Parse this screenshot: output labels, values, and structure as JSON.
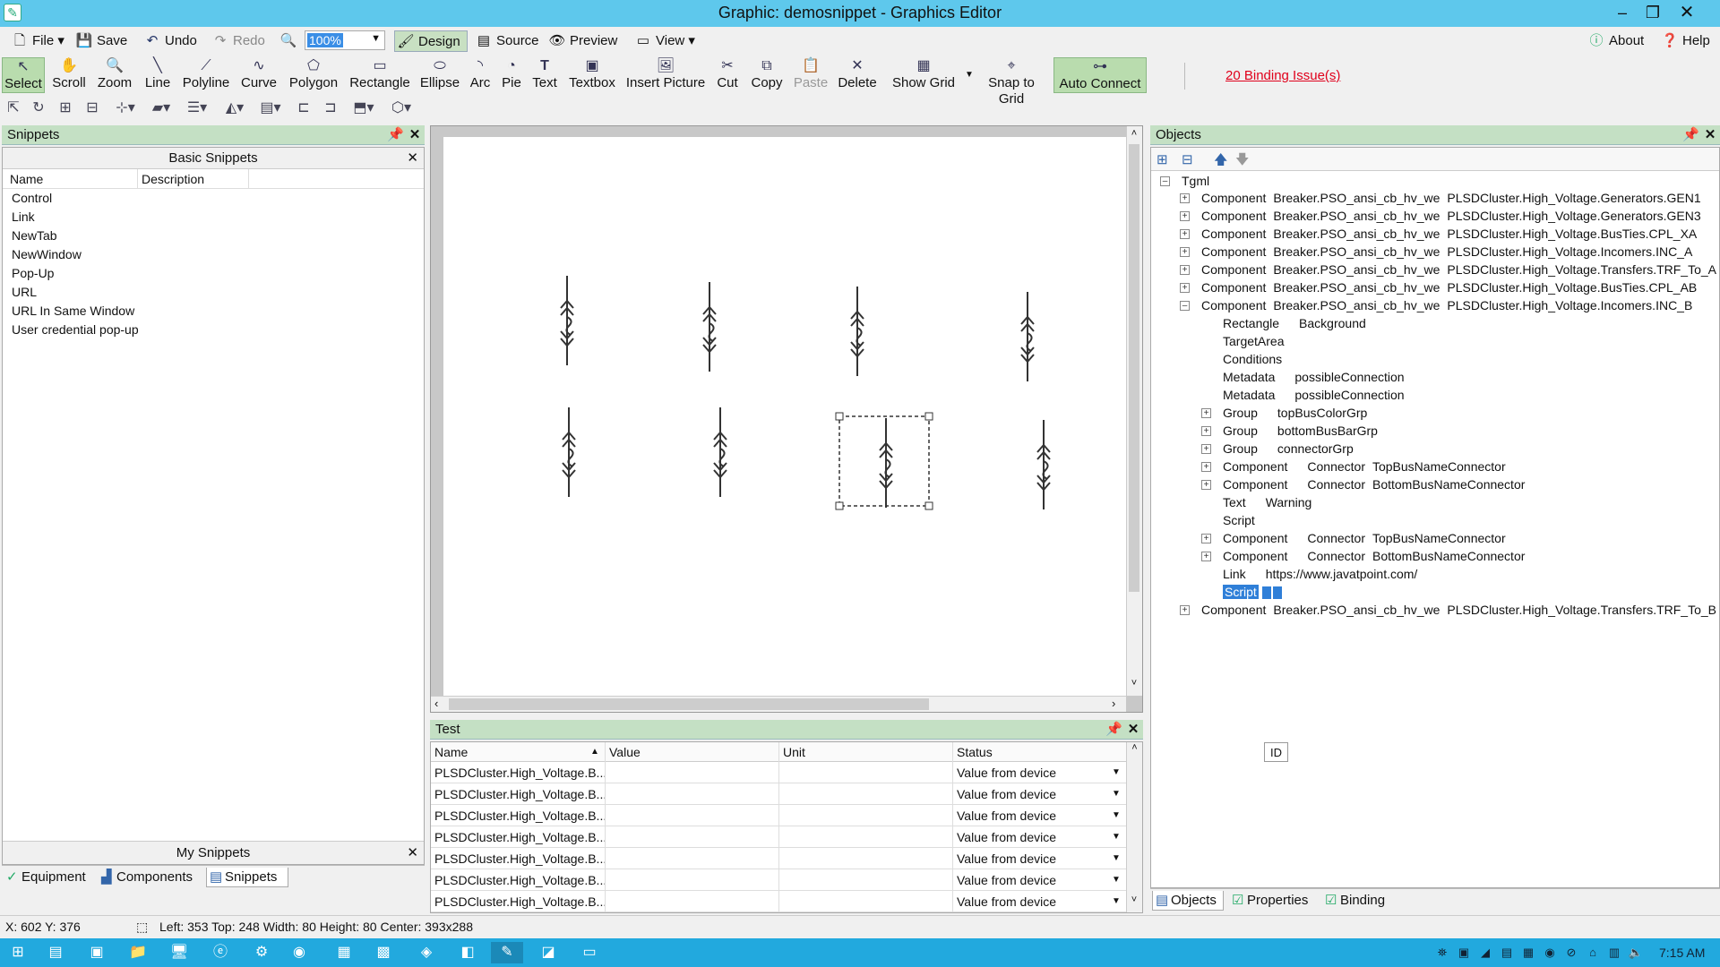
{
  "window": {
    "title": "Graphic: demosnippet - Graphics Editor"
  },
  "menu": {
    "file": "File",
    "save": "Save",
    "undo": "Undo",
    "redo": "Redo",
    "zoom_value": "100%",
    "design": "Design",
    "source": "Source",
    "preview": "Preview",
    "view": "View",
    "about": "About",
    "help": "Help"
  },
  "toolbar": {
    "items": [
      "Select",
      "Scroll",
      "Zoom",
      "Line",
      "Polyline",
      "Curve",
      "Polygon",
      "Rectangle",
      "Ellipse",
      "Arc",
      "Pie",
      "Text",
      "Textbox",
      "Insert Picture",
      "Cut",
      "Copy",
      "Paste",
      "Delete",
      "Show Grid",
      "Snap to Grid",
      "Auto Connect"
    ],
    "binding_issues": "20 Binding Issue(s)"
  },
  "snippets": {
    "panel_title": "Snippets",
    "section_title": "Basic Snippets",
    "col_name": "Name",
    "col_desc": "Description",
    "items": [
      "Control",
      "Link",
      "NewTab",
      "NewWindow",
      "Pop-Up",
      "URL",
      "URL In Same Window",
      "User credential pop-up"
    ],
    "my_snippets": "My Snippets"
  },
  "left_tabs": [
    "Equipment",
    "Components",
    "Snippets"
  ],
  "objects": {
    "panel_title": "Objects",
    "root": "Tgml",
    "rows": [
      {
        "level": 1,
        "exp": "+",
        "a": "Component",
        "b": "Breaker.PSO_ansi_cb_hv_we",
        "c": "PLSDCluster.High_Voltage.Generators.GEN1"
      },
      {
        "level": 1,
        "exp": "+",
        "a": "Component",
        "b": "Breaker.PSO_ansi_cb_hv_we",
        "c": "PLSDCluster.High_Voltage.Generators.GEN3"
      },
      {
        "level": 1,
        "exp": "+",
        "a": "Component",
        "b": "Breaker.PSO_ansi_cb_hv_we",
        "c": "PLSDCluster.High_Voltage.BusTies.CPL_XA"
      },
      {
        "level": 1,
        "exp": "+",
        "a": "Component",
        "b": "Breaker.PSO_ansi_cb_hv_we",
        "c": "PLSDCluster.High_Voltage.Incomers.INC_A"
      },
      {
        "level": 1,
        "exp": "+",
        "a": "Component",
        "b": "Breaker.PSO_ansi_cb_hv_we",
        "c": "PLSDCluster.High_Voltage.Transfers.TRF_To_A"
      },
      {
        "level": 1,
        "exp": "+",
        "a": "Component",
        "b": "Breaker.PSO_ansi_cb_hv_we",
        "c": "PLSDCluster.High_Voltage.BusTies.CPL_AB"
      },
      {
        "level": 1,
        "exp": "-",
        "a": "Component",
        "b": "Breaker.PSO_ansi_cb_hv_we",
        "c": "PLSDCluster.High_Voltage.Incomers.INC_B"
      },
      {
        "level": 2,
        "exp": "",
        "a": "Rectangle",
        "b": "Background",
        "c": ""
      },
      {
        "level": 2,
        "exp": "",
        "a": "TargetArea",
        "b": "",
        "c": ""
      },
      {
        "level": 2,
        "exp": "",
        "a": "Conditions",
        "b": "",
        "c": ""
      },
      {
        "level": 2,
        "exp": "",
        "a": "Metadata",
        "b": "possibleConnection",
        "c": ""
      },
      {
        "level": 2,
        "exp": "",
        "a": "Metadata",
        "b": "possibleConnection",
        "c": ""
      },
      {
        "level": 2,
        "exp": "+",
        "a": "Group",
        "b": "topBusColorGrp",
        "c": ""
      },
      {
        "level": 2,
        "exp": "+",
        "a": "Group",
        "b": "bottomBusBarGrp",
        "c": ""
      },
      {
        "level": 2,
        "exp": "+",
        "a": "Group",
        "b": "connectorGrp",
        "c": ""
      },
      {
        "level": 2,
        "exp": "+",
        "a": "Component",
        "b": "Connector",
        "c": "TopBusNameConnector"
      },
      {
        "level": 2,
        "exp": "+",
        "a": "Component",
        "b": "Connector",
        "c": "BottomBusNameConnector"
      },
      {
        "level": 2,
        "exp": "",
        "a": "Text",
        "b": "Warning",
        "c": ""
      },
      {
        "level": 2,
        "exp": "",
        "a": "Script",
        "b": "",
        "c": ""
      },
      {
        "level": 2,
        "exp": "+",
        "a": "Component",
        "b": "Connector",
        "c": "TopBusNameConnector"
      },
      {
        "level": 2,
        "exp": "+",
        "a": "Component",
        "b": "Connector",
        "c": "BottomBusNameConnector"
      },
      {
        "level": 2,
        "exp": "",
        "a": "Link",
        "b": "https://www.javatpoint.com/",
        "c": ""
      },
      {
        "level": 2,
        "exp": "",
        "a": "Script",
        "b": "",
        "c": "",
        "selected": true
      },
      {
        "level": 1,
        "exp": "+",
        "a": "Component",
        "b": "Breaker.PSO_ansi_cb_hv_we",
        "c": "PLSDCluster.High_Voltage.Transfers.TRF_To_B"
      }
    ],
    "tooltip": "ID"
  },
  "right_tabs": [
    "Objects",
    "Properties",
    "Binding"
  ],
  "test": {
    "panel_title": "Test",
    "columns": [
      "Name",
      "Value",
      "Unit",
      "Status"
    ],
    "rows": [
      {
        "name": "PLSDCluster.High_Voltage.B...",
        "status": "Value from device"
      },
      {
        "name": "PLSDCluster.High_Voltage.B...",
        "status": "Value from device"
      },
      {
        "name": "PLSDCluster.High_Voltage.B...",
        "status": "Value from device"
      },
      {
        "name": "PLSDCluster.High_Voltage.B...",
        "status": "Value from device"
      },
      {
        "name": "PLSDCluster.High_Voltage.B...",
        "status": "Value from device"
      },
      {
        "name": "PLSDCluster.High_Voltage.B...",
        "status": "Value from device"
      },
      {
        "name": "PLSDCluster.High_Voltage.B...",
        "status": "Value from device"
      }
    ]
  },
  "status": {
    "cursor": "X: 602  Y: 376",
    "geometry": "Left: 353  Top: 248  Width: 80  Height: 80  Center: 393x288"
  },
  "taskbar": {
    "time": "7:15 AM"
  },
  "colors": {
    "titlebar": "#5ec8ec",
    "panel_header": "#c4e0c4",
    "accent": "#3a8ee6",
    "taskbar": "#22a9de",
    "issue": "#e0001b"
  }
}
